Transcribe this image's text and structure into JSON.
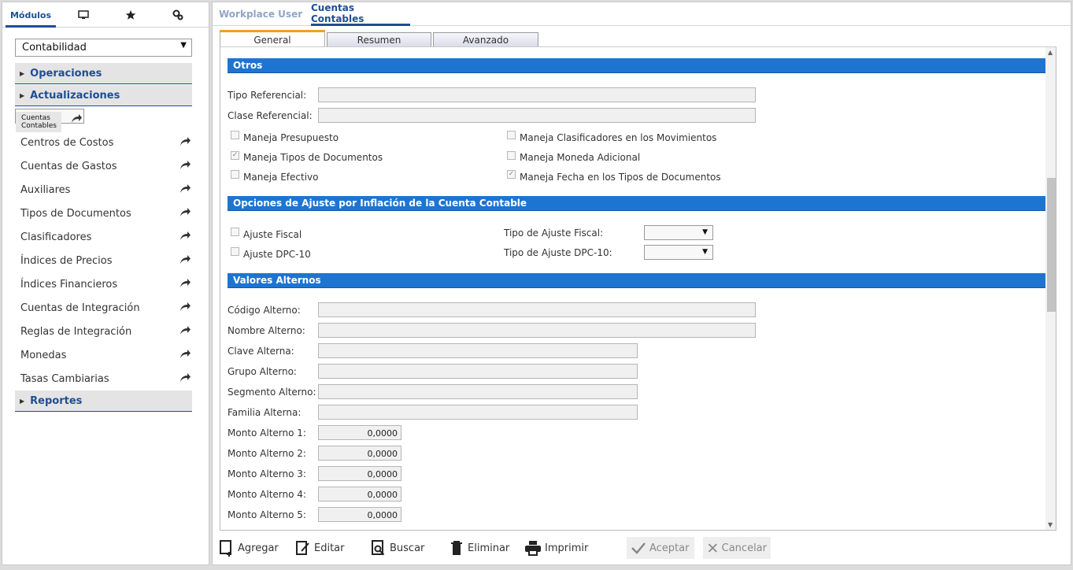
{
  "left_tabs": {
    "modulos": "Módulos",
    "monitor_icon": "monitor-icon",
    "star_icon": "star-icon",
    "gears_icon": "gears-icon"
  },
  "module_select": {
    "value": "Contabilidad"
  },
  "sections": {
    "operaciones": "Operaciones",
    "actualizaciones": "Actualizaciones",
    "reportes": "Reportes"
  },
  "nav_items": [
    "Cuentas Contables",
    "Centros de Costos",
    "Cuentas de Gastos",
    "Auxiliares",
    "Tipos de Documentos",
    "Clasificadores",
    "Índices de Precios",
    "Índices Financieros",
    "Cuentas de Integración",
    "Reglas de Integración",
    "Monedas",
    "Tasas Cambiarias"
  ],
  "top_tabs": {
    "workplace": "Workplace User",
    "cuentas": "Cuentas Contables"
  },
  "form_tabs": {
    "general": "General",
    "resumen": "Resumen",
    "avanzado": "Avanzado"
  },
  "otros": {
    "title": "Otros",
    "tipo_ref": "Tipo Referencial:",
    "clase_ref": "Clase Referencial:",
    "presupuesto": "Maneja Presupuesto",
    "tipos_doc": "Maneja Tipos de Documentos",
    "efectivo": "Maneja Efectivo",
    "clasificadores": "Maneja Clasificadores en los Movimientos",
    "moneda_adic": "Maneja Moneda Adicional",
    "fecha_tipos": "Maneja Fecha en los Tipos de Documentos"
  },
  "ajuste": {
    "title": "Opciones de Ajuste por Inflación de la Cuenta Contable",
    "fiscal": "Ajuste Fiscal",
    "dpc": "Ajuste DPC-10",
    "tipo_fiscal": "Tipo de Ajuste Fiscal:",
    "tipo_dpc": "Tipo de Ajuste DPC-10:"
  },
  "alternos": {
    "title": "Valores Alternos",
    "codigo": "Código Alterno:",
    "nombre": "Nombre Alterno:",
    "clave": "Clave Alterna:",
    "grupo": "Grupo Alterno:",
    "segmento": "Segmento Alterno:",
    "familia": "Familia Alterna:",
    "monto1": "Monto Alterno 1:",
    "monto2": "Monto Alterno 2:",
    "monto3": "Monto Alterno 3:",
    "monto4": "Monto Alterno 4:",
    "monto5": "Monto Alterno 5:",
    "monto_values": [
      "0,0000",
      "0,0000",
      "0,0000",
      "0,0000",
      "0,0000"
    ]
  },
  "checkmark": "✓",
  "toolbar": {
    "agregar": "Agregar",
    "editar": "Editar",
    "buscar": "Buscar",
    "eliminar": "Eliminar",
    "imprimir": "Imprimir",
    "aceptar": "Aceptar",
    "cancelar": "Cancelar"
  },
  "colors": {
    "accent": "#1f4e94",
    "section_bar": "#1e74d1",
    "tab_highlight": "#f0a020"
  }
}
